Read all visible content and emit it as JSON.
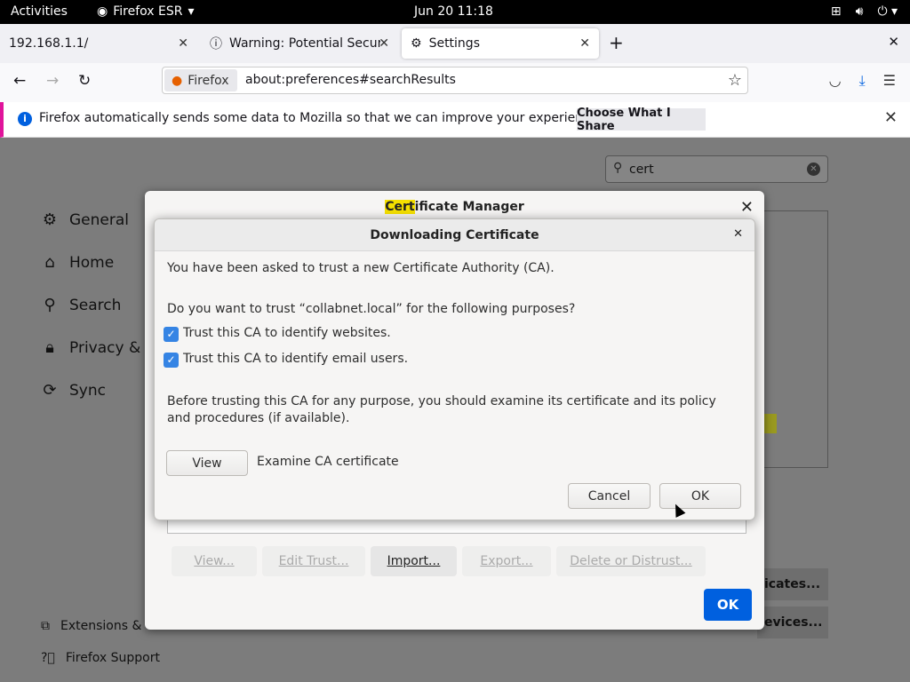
{
  "topbar": {
    "activities": "Activities",
    "app": "Firefox ESR",
    "clock": "Jun 20  11:18"
  },
  "tabs": [
    {
      "label": "192.168.1.1/"
    },
    {
      "label": "Warning: Potential Secur"
    },
    {
      "label": "Settings"
    }
  ],
  "url": {
    "identity": "Firefox",
    "address": "about:preferences#searchResults"
  },
  "notification": {
    "message": "Firefox automatically sends some data to Mozilla so that we can improve your experience.",
    "button": "Choose What I Share"
  },
  "prefs": {
    "search_value": "cert",
    "categories": [
      "General",
      "Home",
      "Search",
      "Privacy & S",
      "Sync"
    ],
    "footer": [
      "Extensions &",
      "Firefox Support"
    ],
    "right_buttons": [
      "icates...",
      "evices..."
    ]
  },
  "cert_manager": {
    "title_highlight": "Cert",
    "title_rest": "ificate Manager",
    "buttons": [
      "View...",
      "Edit Trust...",
      "Import...",
      "Export...",
      "Delete or Distrust..."
    ],
    "ok": "OK"
  },
  "download_dialog": {
    "title": "Downloading Certificate",
    "intro": "You have been asked to trust a new Certificate Authority (CA).",
    "question": "Do you want to trust “collabnet.local” for the following purposes?",
    "check1": "Trust this CA to identify websites.",
    "check2": "Trust this CA to identify email users.",
    "advice": "Before trusting this CA for any purpose, you should examine its certificate and its policy and procedures (if available).",
    "view_button": "View",
    "view_label": "Examine CA certificate",
    "cancel": "Cancel",
    "ok": "OK"
  }
}
